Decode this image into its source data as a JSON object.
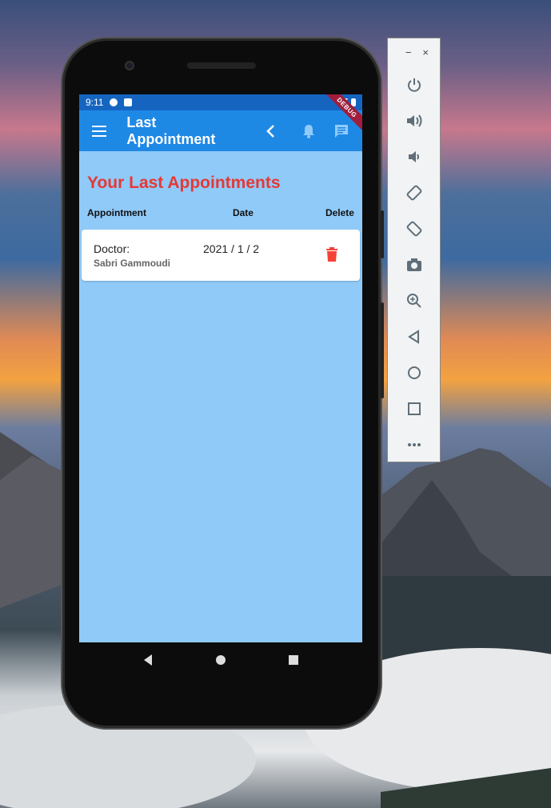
{
  "status_bar": {
    "time": "9:11"
  },
  "app_bar": {
    "title": "Last Appointment",
    "debug_label": "DEBUG"
  },
  "page": {
    "heading": "Your Last Appointments",
    "columns": [
      "Appointment",
      "Date",
      "Delete"
    ],
    "appointments": [
      {
        "doctor_label": "Doctor:",
        "doctor_name": "Sabri Gammoudi",
        "date": "2021 / 1 / 2"
      }
    ]
  },
  "emulator": {
    "window_controls": [
      "−",
      "×"
    ],
    "tools": [
      "power-icon",
      "volume-up-icon",
      "volume-down-icon",
      "rotate-left-icon",
      "rotate-right-icon",
      "camera-icon",
      "zoom-icon",
      "back-icon",
      "home-icon",
      "overview-icon",
      "more-icon"
    ]
  },
  "colors": {
    "appbar": "#1e88e5",
    "statusbar": "#1565c0",
    "screen_bg": "#90caf9",
    "heading": "#e53935",
    "delete": "#f44336"
  }
}
